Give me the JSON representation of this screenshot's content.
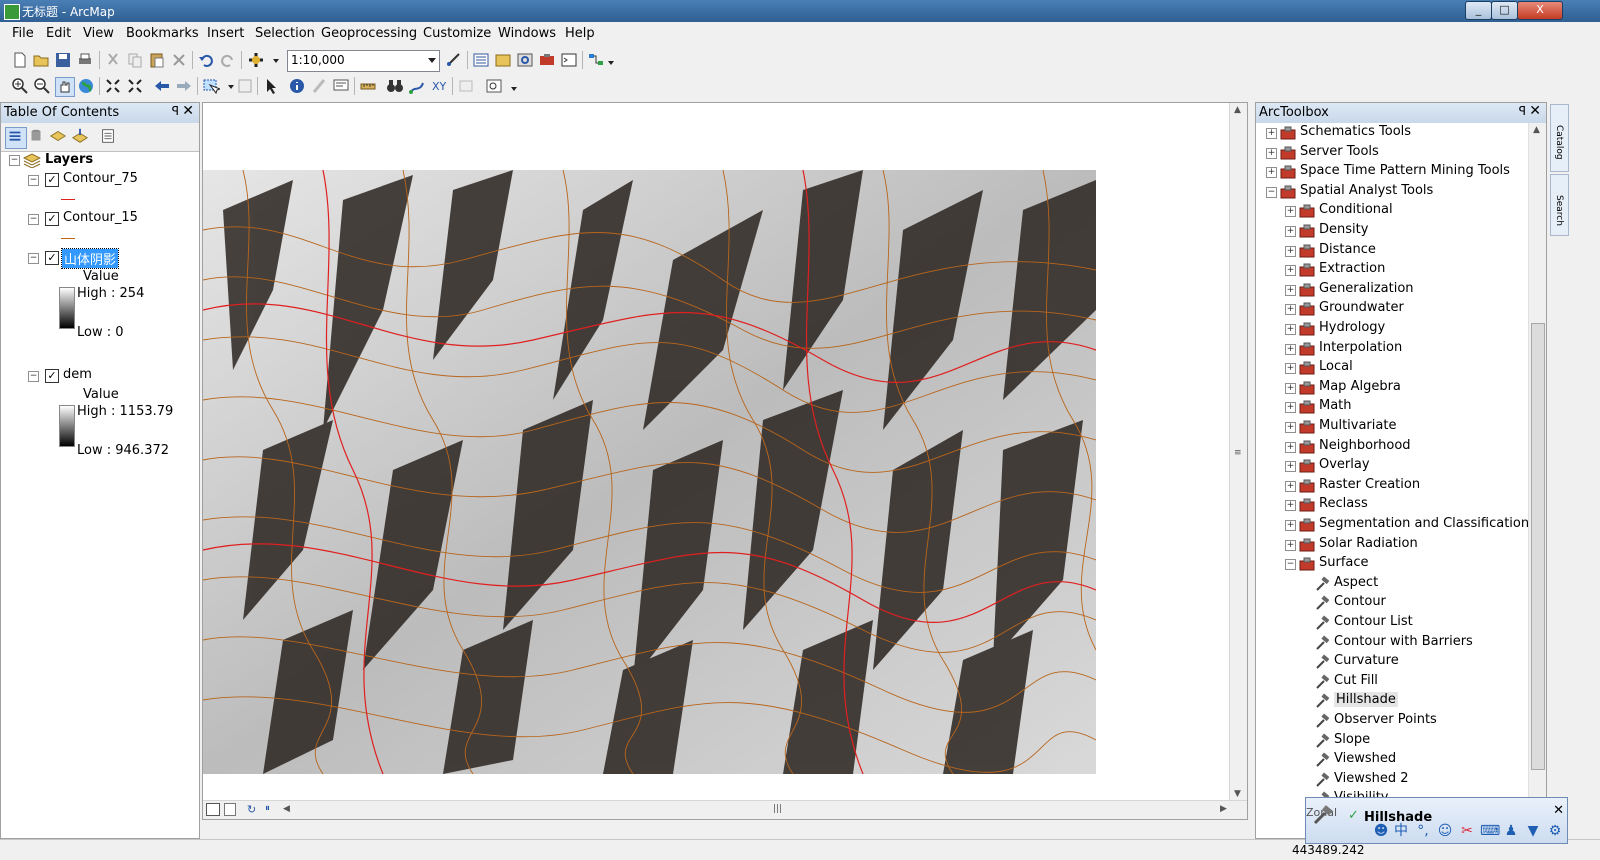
{
  "window": {
    "title": "无标题 - ArcMap",
    "controls": [
      "_",
      "□",
      "X"
    ]
  },
  "menu": [
    "File",
    "Edit",
    "View",
    "Bookmarks",
    "Insert",
    "Selection",
    "Geoprocessing",
    "Customize",
    "Windows",
    "Help"
  ],
  "toolbar": {
    "scale": "1:10,000"
  },
  "toc": {
    "title": "Table Of Contents",
    "pin": "ꟼ",
    "close": "✕",
    "root": "Layers",
    "layers": [
      {
        "name": "Contour_75",
        "checked": true,
        "legend_color": "#e02020"
      },
      {
        "name": "Contour_15",
        "checked": true,
        "legend_color": "#b8651b"
      },
      {
        "name": "山体阴影",
        "checked": true,
        "selected": true,
        "value_label": "Value",
        "high": "High : 254",
        "low": "Low : 0"
      },
      {
        "name": "dem",
        "checked": true,
        "value_label": "Value",
        "high": "High : 1153.79",
        "low": "Low : 946.372"
      }
    ]
  },
  "toolbox": {
    "title": "ArcToolbox",
    "items": [
      {
        "label": "Schematics Tools",
        "level": 0,
        "expanded": false
      },
      {
        "label": "Server Tools",
        "level": 0,
        "expanded": false
      },
      {
        "label": "Space Time Pattern Mining Tools",
        "level": 0,
        "expanded": false
      },
      {
        "label": "Spatial Analyst Tools",
        "level": 0,
        "expanded": true
      },
      {
        "label": "Conditional",
        "level": 1,
        "expanded": false
      },
      {
        "label": "Density",
        "level": 1,
        "expanded": false
      },
      {
        "label": "Distance",
        "level": 1,
        "expanded": false
      },
      {
        "label": "Extraction",
        "level": 1,
        "expanded": false
      },
      {
        "label": "Generalization",
        "level": 1,
        "expanded": false
      },
      {
        "label": "Groundwater",
        "level": 1,
        "expanded": false
      },
      {
        "label": "Hydrology",
        "level": 1,
        "expanded": false
      },
      {
        "label": "Interpolation",
        "level": 1,
        "expanded": false
      },
      {
        "label": "Local",
        "level": 1,
        "expanded": false
      },
      {
        "label": "Map Algebra",
        "level": 1,
        "expanded": false
      },
      {
        "label": "Math",
        "level": 1,
        "expanded": false
      },
      {
        "label": "Multivariate",
        "level": 1,
        "expanded": false
      },
      {
        "label": "Neighborhood",
        "level": 1,
        "expanded": false
      },
      {
        "label": "Overlay",
        "level": 1,
        "expanded": false
      },
      {
        "label": "Raster Creation",
        "level": 1,
        "expanded": false
      },
      {
        "label": "Reclass",
        "level": 1,
        "expanded": false
      },
      {
        "label": "Segmentation and Classification",
        "level": 1,
        "expanded": false
      },
      {
        "label": "Solar Radiation",
        "level": 1,
        "expanded": false
      },
      {
        "label": "Surface",
        "level": 1,
        "expanded": true
      },
      {
        "label": "Aspect",
        "level": 2
      },
      {
        "label": "Contour",
        "level": 2
      },
      {
        "label": "Contour List",
        "level": 2
      },
      {
        "label": "Contour with Barriers",
        "level": 2
      },
      {
        "label": "Curvature",
        "level": 2
      },
      {
        "label": "Cut Fill",
        "level": 2
      },
      {
        "label": "Hillshade",
        "level": 2,
        "highlighted": true
      },
      {
        "label": "Observer Points",
        "level": 2
      },
      {
        "label": "Slope",
        "level": 2
      },
      {
        "label": "Viewshed",
        "level": 2
      },
      {
        "label": "Viewshed 2",
        "level": 2
      },
      {
        "label": "Visibility",
        "level": 2
      }
    ]
  },
  "side_tabs": [
    "Catalog",
    "Search"
  ],
  "status": {
    "coords": "443489.242"
  },
  "progress_popup": {
    "title": "Hillshade",
    "tool_label": "Zonal"
  },
  "colors": {
    "accent": "#3399ff",
    "contour_major": "#e02020",
    "contour_minor": "#b8651b",
    "title_bar": "#2f5f93"
  }
}
